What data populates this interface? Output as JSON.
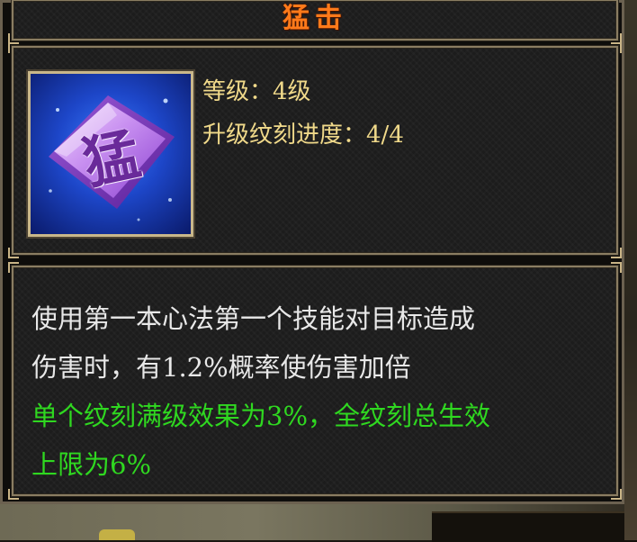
{
  "skill": {
    "name": "猛击",
    "icon_glyph": "猛",
    "icon_name": "skill-meng-icon"
  },
  "info": {
    "level_label": "等级：",
    "level_value": "4级",
    "progress_label": "升级纹刻进度：",
    "progress_value": "4/4",
    "progress_fraction": 1.0
  },
  "description": {
    "effect_line1": "使用第一本心法第一个技能对目标造成",
    "effect_line2": "伤害时，有1.2%概率使伤害加倍",
    "bonus_line1": "单个纹刻满级效果为3%，全纹刻总生效",
    "bonus_line2": "上限为6%"
  },
  "colors": {
    "title": "#ff7a1a",
    "info_text": "#f0d98a",
    "effect_text": "#e8e8e8",
    "bonus_text": "#2fd820",
    "frame": "#8a7d62"
  }
}
